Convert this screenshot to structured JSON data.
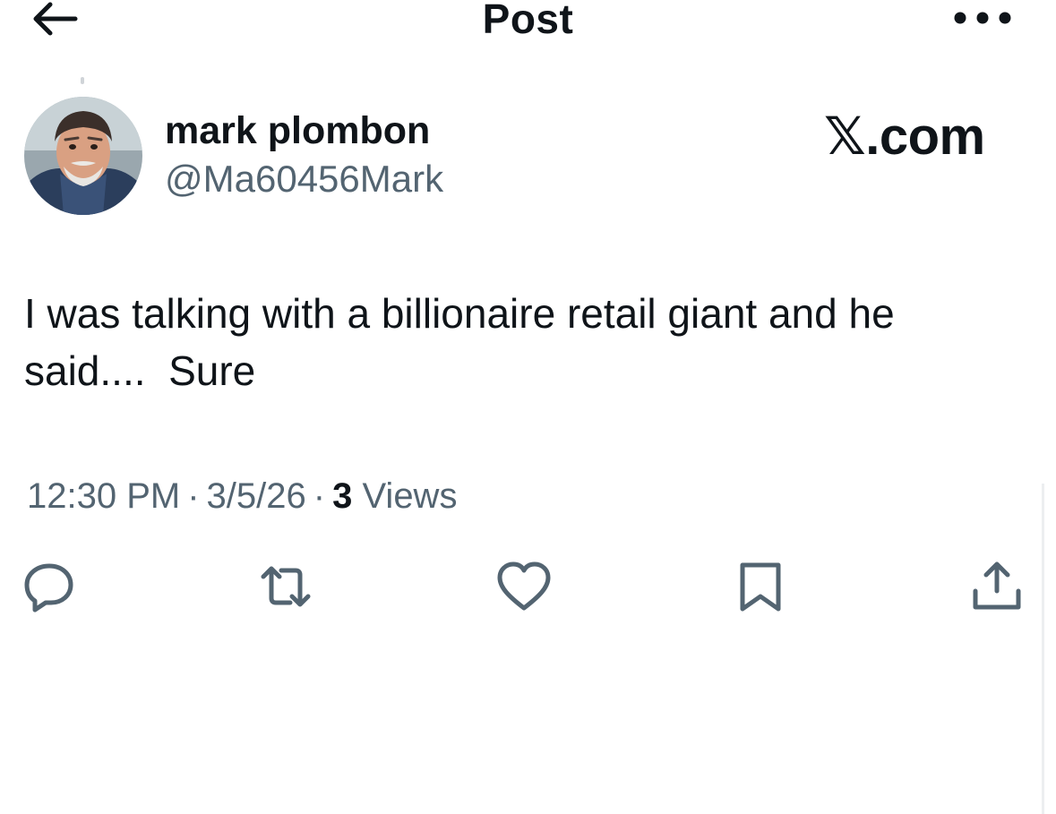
{
  "header": {
    "title": "Post"
  },
  "author": {
    "display_name": "mark plombon",
    "handle": "@Ma60456Mark"
  },
  "watermark": "𝕏.com",
  "post": {
    "text": "I was talking with a billionaire retail giant and he said....  Sure"
  },
  "meta": {
    "time": "12:30 PM",
    "date": "3/5/26",
    "views_count": "3",
    "views_label": "Views",
    "separator": "·"
  },
  "icons": {
    "back": "arrow-left-icon",
    "more": "more-horizontal-icon",
    "reply": "reply-icon",
    "repost": "repost-icon",
    "like": "heart-icon",
    "bookmark": "bookmark-icon",
    "share": "share-icon"
  },
  "colors": {
    "text_primary": "#0f1419",
    "text_secondary": "#536471",
    "icon": "#536471"
  }
}
